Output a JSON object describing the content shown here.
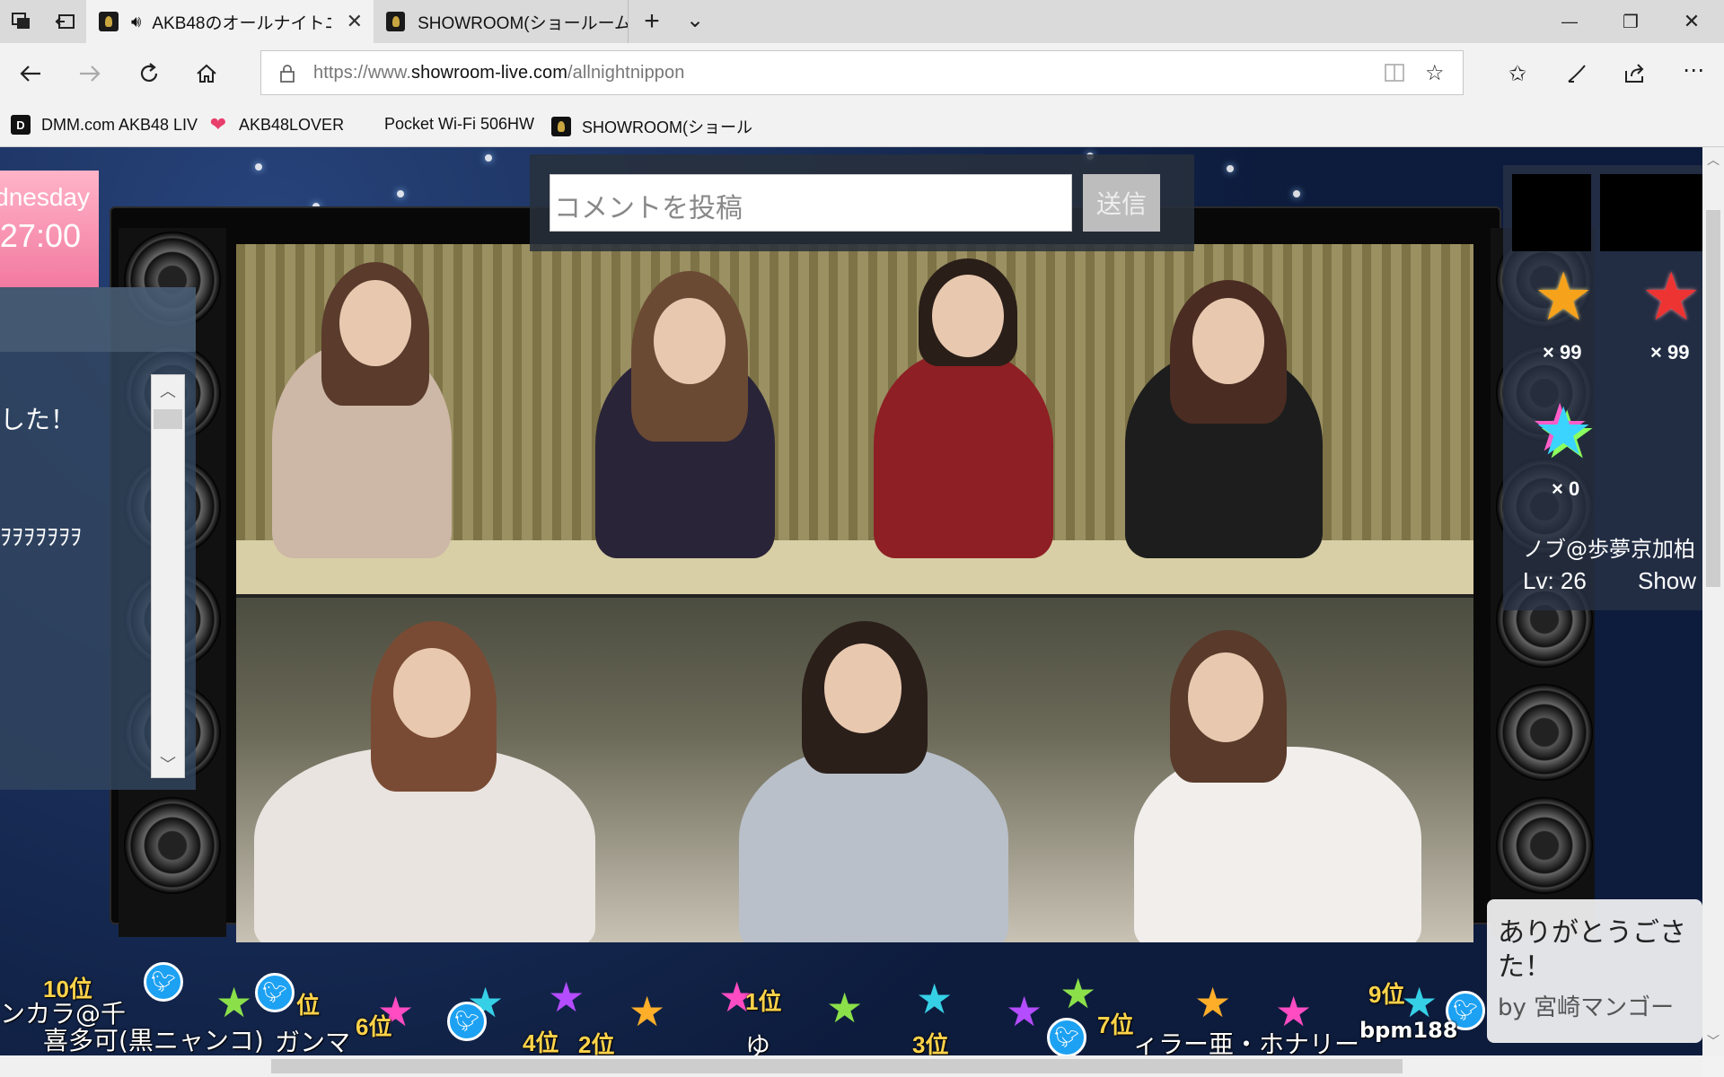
{
  "browser": {
    "tabs": [
      {
        "title": "AKB48のオールナイトニ",
        "active": true,
        "audio": true
      },
      {
        "title": "SHOWROOM(ショールーム)",
        "active": false
      }
    ],
    "new_tab": "+",
    "tab_list": "⌄",
    "minimize": "—",
    "restore": "❐",
    "close": "✕",
    "url_prefix": "https://www.",
    "url_domain": "showroom-live.com",
    "url_path": "/allnightnippon",
    "bookmarks": [
      {
        "label": "DMM.com AKB48 LIV",
        "icon": "dmm-icon"
      },
      {
        "label": "AKB48LOVER",
        "icon": "heart-icon"
      },
      {
        "label": "Pocket Wi-Fi 506HW",
        "icon": ""
      },
      {
        "label": "SHOWROOM(ショール",
        "icon": "showroom-icon"
      }
    ]
  },
  "room": {
    "comment_placeholder": "コメントを投稿",
    "send_label": "送信",
    "date_day": "dnesday",
    "date_time": "27:00",
    "comments": [
      "した！",
      "ｦｦｦｦｦｦｦ"
    ],
    "gifts": [
      {
        "count": "× 99",
        "color": "#f7a21b"
      },
      {
        "count": "× 99",
        "color": "#ee3333"
      },
      {
        "count": "× 0",
        "color": "rainbow"
      }
    ],
    "viewer_name": "ノブ@歩夢京加柏",
    "viewer_level": "Lv: 26",
    "viewer_show": "Show",
    "thanks_line1": "ありがとうごさ",
    "thanks_line2": "た！",
    "thanks_by": "by 宮崎マンゴー",
    "ranking": [
      {
        "rank": "10位",
        "name": "ンカラ@千"
      },
      {
        "rank": "",
        "name": "喜多可(黒ニャンコ)"
      },
      {
        "rank": "位",
        "name": "ガンマ"
      },
      {
        "rank": "6位",
        "name": ""
      },
      {
        "rank": "4位",
        "name": ""
      },
      {
        "rank": "2位",
        "name": ""
      },
      {
        "rank": "1位",
        "name": "ゆ"
      },
      {
        "rank": "3位",
        "name": ""
      },
      {
        "rank": "7位",
        "name": "ィラー亜・ホナリー"
      },
      {
        "rank": "9位",
        "name": "bpm188"
      }
    ]
  }
}
